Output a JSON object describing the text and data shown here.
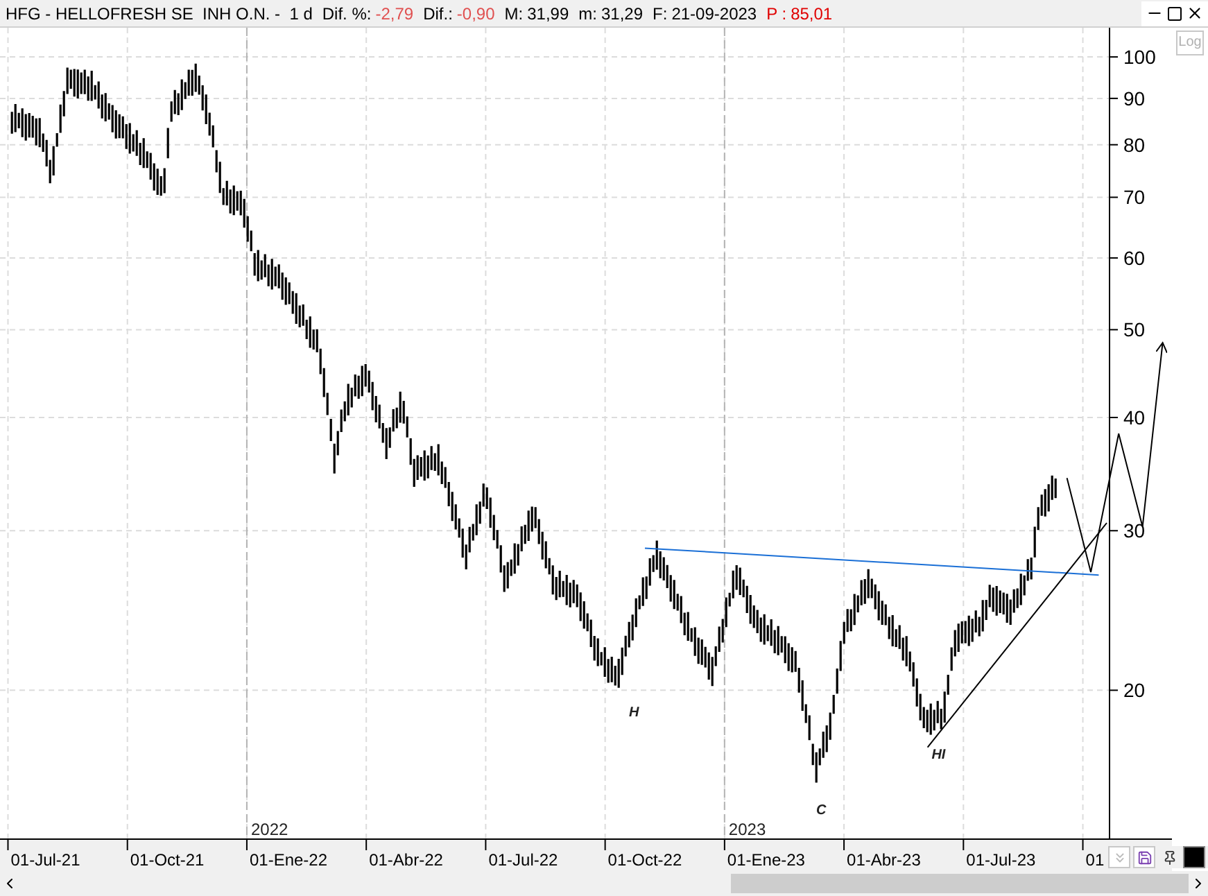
{
  "title_bar": {
    "title": "HFG - HELLOFRESH SE  INH O.N. -  1 d",
    "stats": [
      {
        "label": "Dif. %:",
        "value": "-2,79",
        "kind": "change"
      },
      {
        "label": "Dif.:",
        "value": "-0,90",
        "kind": "change"
      },
      {
        "label": "M:",
        "value": "31,99",
        "kind": "plain"
      },
      {
        "label": "m:",
        "value": "31,29",
        "kind": "plain"
      },
      {
        "label": "F:",
        "value": "21-09-2023",
        "kind": "plain"
      },
      {
        "label": "P :",
        "value": "85,01",
        "kind": "alert"
      }
    ]
  },
  "scale_button": {
    "label": "Log"
  },
  "chart": {
    "y_axis_labels": [
      "100",
      "90",
      "80",
      "70",
      "60",
      "50",
      "40",
      "30",
      "20"
    ],
    "year_labels": [
      "2022",
      "2023"
    ],
    "x_axis_labels": [
      "01-Jul-21",
      "01-Oct-21",
      "01-Ene-22",
      "01-Abr-22",
      "01-Jul-22",
      "01-Oct-22",
      "01-Ene-23",
      "01-Abr-23",
      "01-Jul-23",
      "01"
    ],
    "pattern_labels": [
      "H",
      "C",
      "HI"
    ]
  }
}
